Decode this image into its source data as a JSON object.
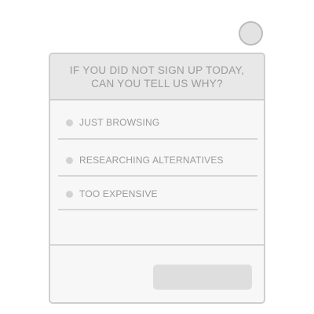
{
  "survey": {
    "title": "IF YOU DID NOT SIGN UP TODAY, CAN YOU TELL US WHY?",
    "options": [
      {
        "label": "JUST BROWSING"
      },
      {
        "label": "RESEARCHING ALTERNATIVES"
      },
      {
        "label": "TOO EXPENSIVE"
      }
    ],
    "submit_label": ""
  },
  "icons": {
    "close": "close-icon",
    "radio": "radio-icon"
  },
  "colors": {
    "header_bg": "#e8e8e8",
    "card_bg": "#f7f7f7",
    "border": "#cfcfcf",
    "text": "#9b9b9b",
    "button_bg": "#dedede"
  }
}
